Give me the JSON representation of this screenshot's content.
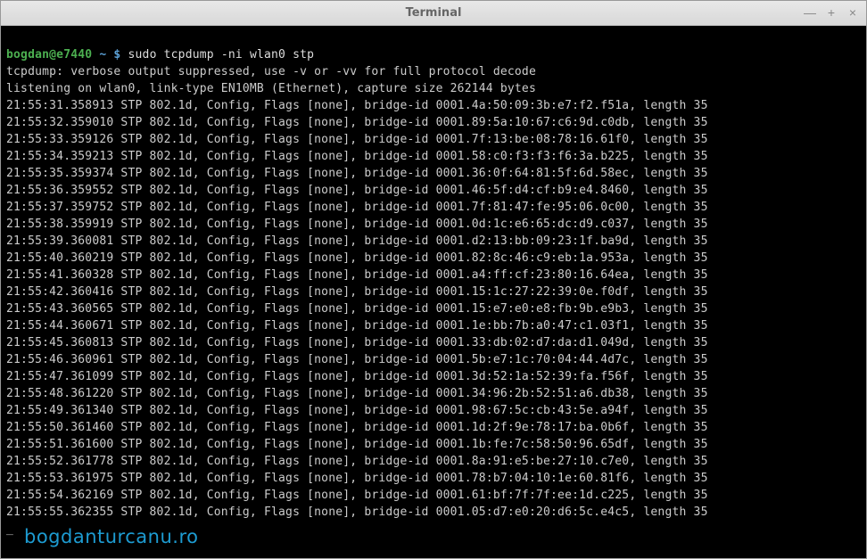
{
  "window": {
    "title": "Terminal",
    "controls": {
      "min": "—",
      "max": "+",
      "close": "×"
    }
  },
  "prompt": {
    "user_host": "bogdan@e7440",
    "tilde": "~",
    "sigil": "$"
  },
  "command": "sudo tcpdump -ni wlan0 stp",
  "header1": "tcpdump: verbose output suppressed, use -v or -vv for full protocol decode",
  "header2": "listening on wlan0, link-type EN10MB (Ethernet), capture size 262144 bytes",
  "lines": [
    "21:55:31.358913 STP 802.1d, Config, Flags [none], bridge-id 0001.4a:50:09:3b:e7:f2.f51a, length 35",
    "21:55:32.359010 STP 802.1d, Config, Flags [none], bridge-id 0001.89:5a:10:67:c6:9d.c0db, length 35",
    "21:55:33.359126 STP 802.1d, Config, Flags [none], bridge-id 0001.7f:13:be:08:78:16.61f0, length 35",
    "21:55:34.359213 STP 802.1d, Config, Flags [none], bridge-id 0001.58:c0:f3:f3:f6:3a.b225, length 35",
    "21:55:35.359374 STP 802.1d, Config, Flags [none], bridge-id 0001.36:0f:64:81:5f:6d.58ec, length 35",
    "21:55:36.359552 STP 802.1d, Config, Flags [none], bridge-id 0001.46:5f:d4:cf:b9:e4.8460, length 35",
    "21:55:37.359752 STP 802.1d, Config, Flags [none], bridge-id 0001.7f:81:47:fe:95:06.0c00, length 35",
    "21:55:38.359919 STP 802.1d, Config, Flags [none], bridge-id 0001.0d:1c:e6:65:dc:d9.c037, length 35",
    "21:55:39.360081 STP 802.1d, Config, Flags [none], bridge-id 0001.d2:13:bb:09:23:1f.ba9d, length 35",
    "21:55:40.360219 STP 802.1d, Config, Flags [none], bridge-id 0001.82:8c:46:c9:eb:1a.953a, length 35",
    "21:55:41.360328 STP 802.1d, Config, Flags [none], bridge-id 0001.a4:ff:cf:23:80:16.64ea, length 35",
    "21:55:42.360416 STP 802.1d, Config, Flags [none], bridge-id 0001.15:1c:27:22:39:0e.f0df, length 35",
    "21:55:43.360565 STP 802.1d, Config, Flags [none], bridge-id 0001.15:e7:e0:e8:fb:9b.e9b3, length 35",
    "21:55:44.360671 STP 802.1d, Config, Flags [none], bridge-id 0001.1e:bb:7b:a0:47:c1.03f1, length 35",
    "21:55:45.360813 STP 802.1d, Config, Flags [none], bridge-id 0001.33:db:02:d7:da:d1.049d, length 35",
    "21:55:46.360961 STP 802.1d, Config, Flags [none], bridge-id 0001.5b:e7:1c:70:04:44.4d7c, length 35",
    "21:55:47.361099 STP 802.1d, Config, Flags [none], bridge-id 0001.3d:52:1a:52:39:fa.f56f, length 35",
    "21:55:48.361220 STP 802.1d, Config, Flags [none], bridge-id 0001.34:96:2b:52:51:a6.db38, length 35",
    "21:55:49.361340 STP 802.1d, Config, Flags [none], bridge-id 0001.98:67:5c:cb:43:5e.a94f, length 35",
    "21:55:50.361460 STP 802.1d, Config, Flags [none], bridge-id 0001.1d:2f:9e:78:17:ba.0b6f, length 35",
    "21:55:51.361600 STP 802.1d, Config, Flags [none], bridge-id 0001.1b:fe:7c:58:50:96.65df, length 35",
    "21:55:52.361778 STP 802.1d, Config, Flags [none], bridge-id 0001.8a:91:e5:be:27:10.c7e0, length 35",
    "21:55:53.361975 STP 802.1d, Config, Flags [none], bridge-id 0001.78:b7:04:10:1e:60.81f6, length 35",
    "21:55:54.362169 STP 802.1d, Config, Flags [none], bridge-id 0001.61:bf:7f:7f:ee:1d.c225, length 35",
    "21:55:55.362355 STP 802.1d, Config, Flags [none], bridge-id 0001.05:d7:e0:20:d6:5c.e4c5, length 35"
  ],
  "cursor": "_",
  "watermark": "bogdanturcanu.ro"
}
